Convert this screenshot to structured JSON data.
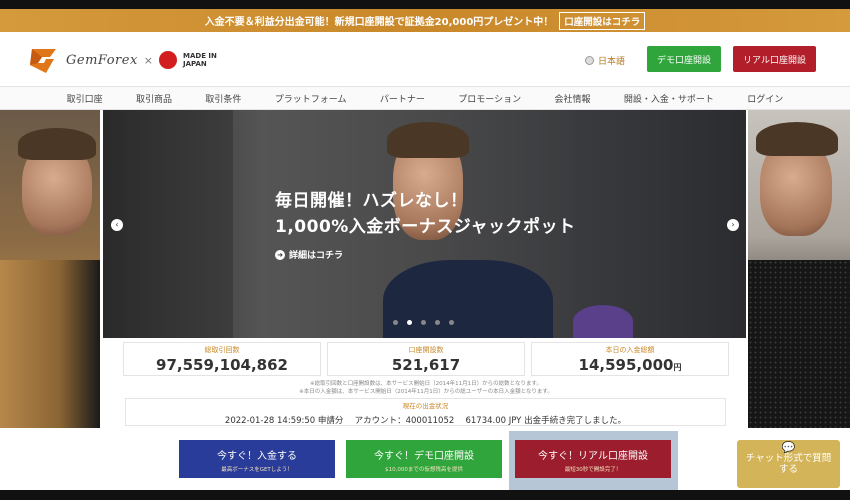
{
  "promo": {
    "text": "入金不要＆利益分出金可能！新規口座開設で証拠金20,000円プレゼント中！",
    "link": "口座開設はコチラ"
  },
  "header": {
    "brand": "GemForex",
    "separator": "×",
    "made_in_1": "MADE IN",
    "made_in_2": "JAPAN",
    "language": "日本語",
    "demo_button": "デモ口座開設",
    "real_button": "リアル口座開設"
  },
  "nav": {
    "items": [
      "取引口座",
      "取引商品",
      "取引条件",
      "プラットフォーム",
      "パートナー",
      "プロモーション",
      "会社情報",
      "開設・入金・サポート",
      "ログイン"
    ]
  },
  "hero": {
    "line1": "毎日開催！ハズレなし！",
    "line2": "1,000%入金ボーナスジャックポット",
    "details_link": "詳細はコチラ",
    "prev_icon": "chevron-left-icon",
    "next_icon": "chevron-right-icon",
    "slide_count": 5,
    "active_slide": 2
  },
  "stats": {
    "trades_label": "総取引回数",
    "trades_value": "97,559,104,862",
    "accounts_label": "口座開設数",
    "accounts_value": "521,617",
    "deposit_label": "本日の入金総額",
    "deposit_value": "14,595,000",
    "deposit_unit": "円"
  },
  "notes": {
    "line1": "※総取引回数と口座開設数は、本サービス開始日（2014年11月1日）からの総数となります。",
    "line2": "※本日の入金額は、本サービス開始日（2014年11月1日）からの総ユーザーの本日入金額となります。"
  },
  "withdrawal_status": {
    "title": "現在の出金状況",
    "text": "2022-01-28 14:59:50 申請分　 アカウント：400011052　 61734.00 JPY 出金手続き完了しました。"
  },
  "bottom_bar": {
    "deposit_label": "今すぐ！入金する",
    "deposit_sub": "最高ボーナスをGETしよう！",
    "demo_label": "今すぐ！デモ口座開設",
    "demo_sub": "$10,000までの仮想残高を提供",
    "real_label": "今すぐ！リアル口座開設",
    "real_sub": "最短30秒で開設完了！"
  },
  "chat": {
    "icon": "chat-bubble-icon",
    "label_line1": "チャット形式で質問",
    "label_line2": "する"
  },
  "colors": {
    "promo_bg": "#c9882a",
    "demo_green": "#2fa53b",
    "real_red": "#b21f2a",
    "deposit_blue": "#2a3c9a",
    "chat_gold": "#d4b458"
  }
}
